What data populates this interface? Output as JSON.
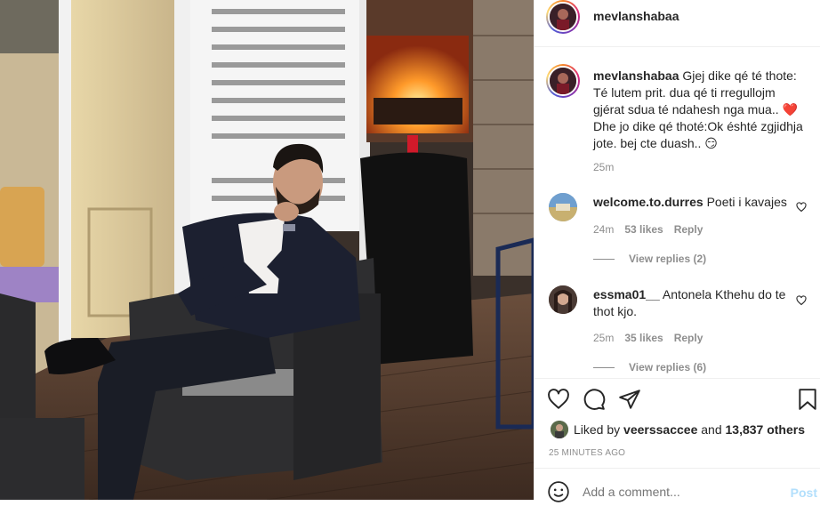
{
  "post": {
    "username": "mevlanshabaa",
    "caption": "Gjej dike qé té thote: Té lutem prit. dua qé ti rregullojm gjérat sdua té ndahesh nga mua.. ❤️ Dhe jo dike qé thoté:Ok éshté zgjidhja jote. bej cte duash.. 😏",
    "caption_time": "25m",
    "timestamp": "25 MINUTES AGO"
  },
  "comments": [
    {
      "username": "welcome.to.durres",
      "text": "Poeti i kavajes",
      "time": "24m",
      "likes": "53 likes",
      "reply_label": "Reply",
      "view_replies": "View replies (2)"
    },
    {
      "username": "essma01__",
      "text": "Antonela Kthehu do te thot kjo.",
      "time": "25m",
      "likes": "35 likes",
      "reply_label": "Reply",
      "view_replies": "View replies (6)"
    }
  ],
  "likes": {
    "prefix": "Liked by",
    "user": "veerssaccee",
    "middle": "and",
    "others": "13,837 others"
  },
  "add_comment": {
    "placeholder": "Add a comment...",
    "post_label": "Post"
  },
  "icons": {
    "like": "heart-icon",
    "comment": "comment-icon",
    "share": "paper-plane-icon",
    "save": "bookmark-icon",
    "emoji": "smiley-icon"
  },
  "colors": {
    "text": "#262626",
    "muted": "#8e8e8e",
    "link": "#b2dffc",
    "border": "#efefef",
    "heart": "#ed4956"
  }
}
